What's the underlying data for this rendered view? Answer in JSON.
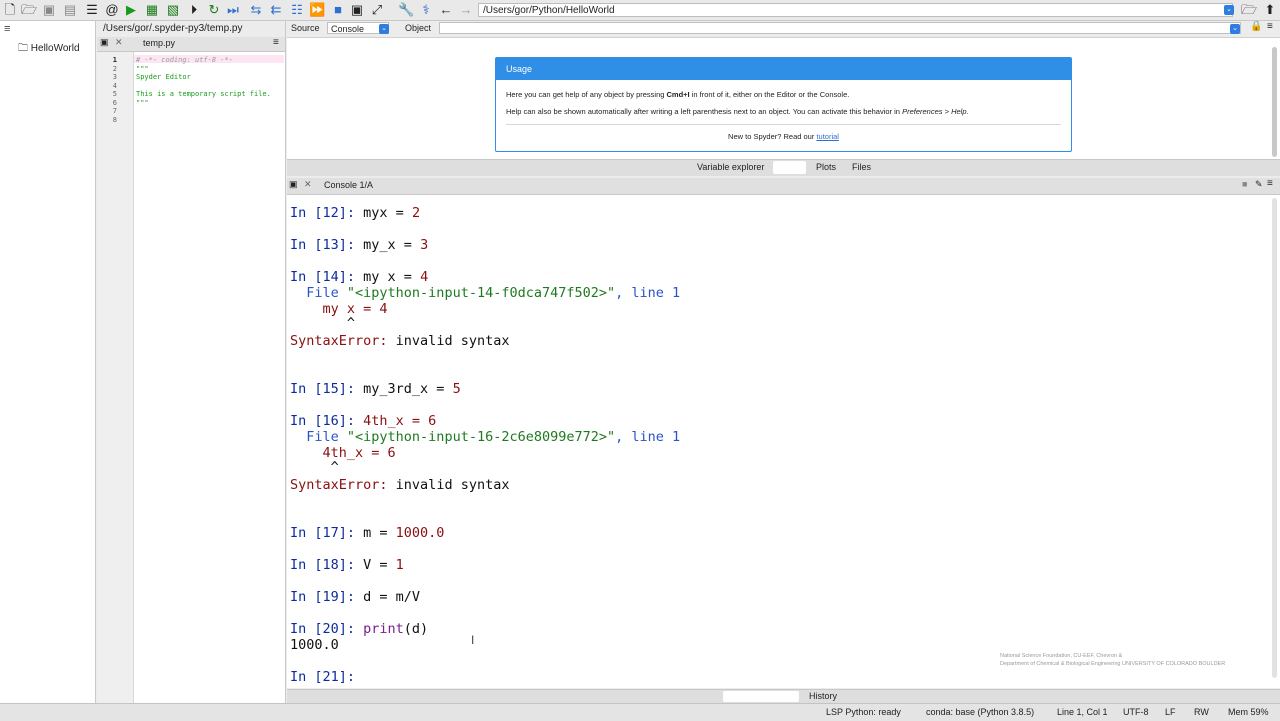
{
  "toolbar": {
    "icons": [
      "new-file-icon",
      "open-folder-icon",
      "save-icon",
      "save-all-icon",
      "browse-tabs-icon",
      "at-icon",
      "run-icon",
      "run-cell-icon",
      "run-cell-advance-icon",
      "run-selection-icon",
      "debug-icon",
      "step-icon",
      "continue-icon",
      "stop-icon",
      "maximize-icon",
      "wrench-icon",
      "python-path-icon",
      "back-icon",
      "forward-icon"
    ],
    "path": "/Users/gor/Python/HelloWorld"
  },
  "project": {
    "root": "HelloWorld"
  },
  "editor": {
    "path": "/Users/gor/.spyder-py3/temp.py",
    "tab": "temp.py",
    "line_numbers": [
      "1",
      "2",
      "3",
      "4",
      "5",
      "6",
      "7",
      "8"
    ],
    "lines": [
      "# -*- coding: utf-8 -*-",
      "\"\"\"",
      "Spyder Editor",
      "",
      "This is a temporary script file.",
      "\"\"\"",
      "",
      ""
    ]
  },
  "help": {
    "source_label": "Source",
    "source_value": "Console",
    "object_label": "Object",
    "usage_title": "Usage",
    "line1_pre": "Here you can get help of any object by pressing ",
    "line1_key": "Cmd+I",
    "line1_post": " in front of it, either on the Editor or the Console.",
    "line2_pre": "Help can also be shown automatically after writing a left parenthesis next to an object. You can activate this behavior in ",
    "line2_em": "Preferences > Help",
    "line2_post": ".",
    "line3_pre": "New to Spyder? Read our ",
    "line3_link": "tutorial",
    "tabs": [
      "Variable explorer",
      "Plots",
      "Files"
    ]
  },
  "console": {
    "tab": "Console 1/A",
    "lines": {
      "l12_p": "In [12]: ",
      "l12_c": "myx = ",
      "l12_n": "2",
      "l13_p": "In [13]: ",
      "l13_c": "my_x = ",
      "l13_n": "3",
      "l14_p": "In [14]: ",
      "l14_c": "my x = ",
      "l14_n": "4",
      "f14_a": "  File ",
      "f14_s": "\"<ipython-input-14-f0dca747f502>\"",
      "f14_b": ", line 1",
      "e14_c": "    my x = 4",
      "e14_caret": "       ^",
      "se1_a": "SyntaxError:",
      "se1_b": " invalid syntax",
      "l15_p": "In [15]: ",
      "l15_c": "my_3rd_x = ",
      "l15_n": "5",
      "l16_p": "In [16]: ",
      "l16_c": "4th_x = 6",
      "f16_a": "  File ",
      "f16_s": "\"<ipython-input-16-2c6e8099e772>\"",
      "f16_b": ", line 1",
      "e16_c": "    4th_x = 6",
      "e16_caret": "     ^",
      "se2_a": "SyntaxError:",
      "se2_b": " invalid syntax",
      "l17_p": "In [17]: ",
      "l17_c": "m = ",
      "l17_n": "1000.0",
      "l18_p": "In [18]: ",
      "l18_c": "V = ",
      "l18_n": "1",
      "l19_p": "In [19]: ",
      "l19_c": "d = m/V",
      "l20_p": "In [20]: ",
      "l20_f": "print",
      "l20_c": "(d)",
      "out20": "1000.0",
      "l21_p": "In [21]: "
    }
  },
  "bottom_tabs": [
    "History"
  ],
  "status": {
    "lsp": "LSP Python: ready",
    "conda": "conda: base (Python 3.8.5)",
    "position": "Line 1, Col 1",
    "encoding": "UTF-8",
    "eol": "LF",
    "rw": "RW",
    "mem": "Mem 59%"
  },
  "watermark": {
    "line1": "National Science Foundation, CU-EEF, Chevron &",
    "line2": "Department of Chemical & Biological Engineering  UNIVERSITY OF COLORADO BOULDER"
  },
  "colors": {
    "accent": "#2f8ee6",
    "prompt": "#0d2b9b",
    "number": "#8a1010"
  }
}
